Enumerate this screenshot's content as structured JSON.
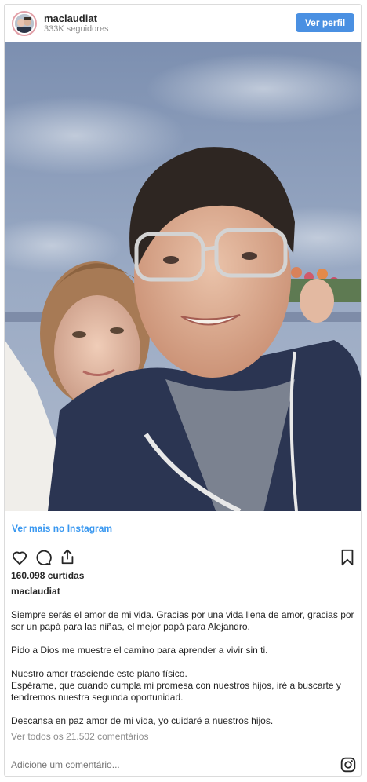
{
  "header": {
    "username": "maclaudiat",
    "followers": "333K seguidores",
    "profile_button": "Ver perfil"
  },
  "photo": {
    "icon": "selfie-photo"
  },
  "view_more_link": "Ver mais no Instagram",
  "actions": {
    "like_icon": "heart-icon",
    "comment_icon": "comment-icon",
    "share_icon": "share-icon",
    "save_icon": "bookmark-icon"
  },
  "likes": "160.098 curtidas",
  "caption": {
    "username": "maclaudiat",
    "paragraphs": [
      "Siempre serás el amor de mi vida. Gracias por una vida llena de amor, gracias por ser un papá para las niñas, el mejor papá para Alejandro.",
      "Pido a Dios me muestre el camino para aprender a vivir sin ti.",
      "Nuestro amor trasciende este plano físico.",
      "Espérame, que cuando cumpla mi promesa con nuestros hijos, iré a buscarte y tendremos nuestra segunda oportunidad.",
      "Descansa en paz amor de mi vida, yo cuidaré a nuestros hijos."
    ]
  },
  "view_comments": "Ver todos os 21.502 comentários",
  "comment_placeholder": "Adicione um comentário...",
  "brand_icon": "instagram-icon",
  "colors": {
    "accent": "#4a90e2",
    "link": "#3897f0",
    "muted": "#8e8e8e",
    "text": "#262626"
  }
}
